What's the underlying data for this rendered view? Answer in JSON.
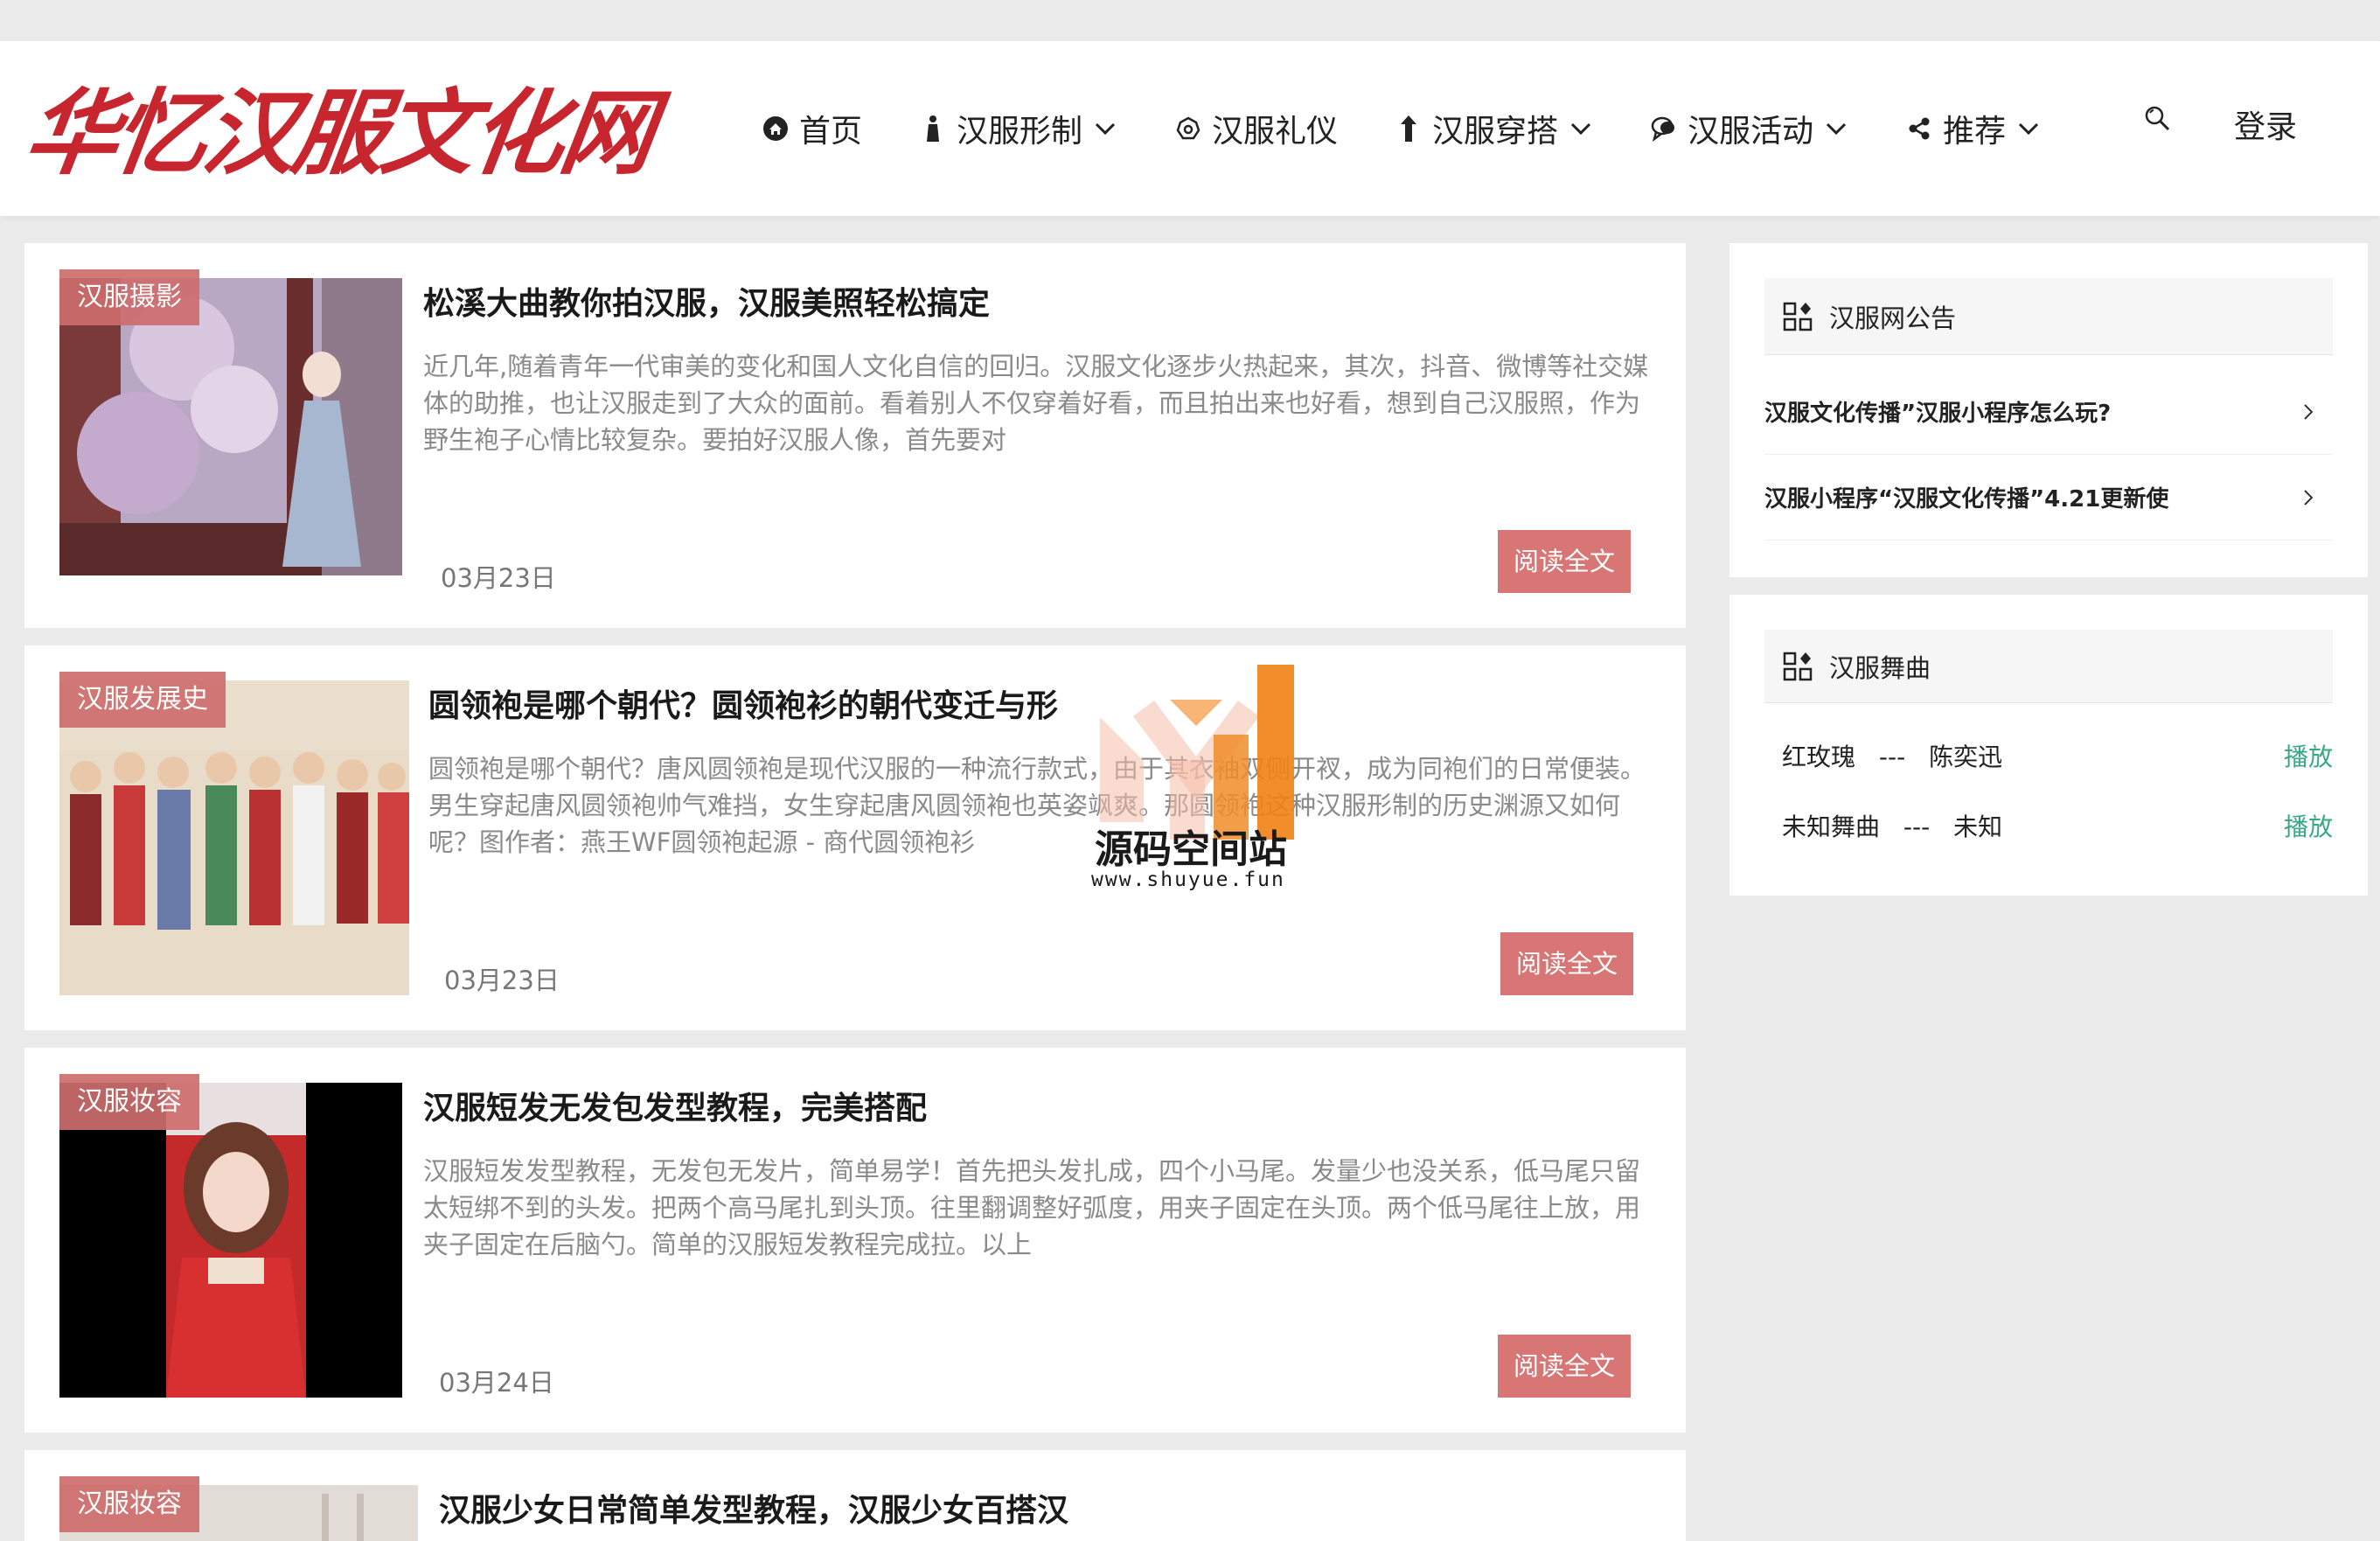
{
  "header": {
    "logo_text": "华忆汉服文化网",
    "nav": [
      {
        "label": "首页",
        "icon": "home-icon",
        "dropdown": false
      },
      {
        "label": "汉服形制",
        "icon": "figure-icon",
        "dropdown": true
      },
      {
        "label": "汉服礼仪",
        "icon": "gear-icon",
        "dropdown": false
      },
      {
        "label": "汉服穿搭",
        "icon": "shirt-icon",
        "dropdown": true
      },
      {
        "label": "汉服活动",
        "icon": "chat-icon",
        "dropdown": true
      },
      {
        "label": "推荐",
        "icon": "share-icon",
        "dropdown": true
      }
    ],
    "login": "登录"
  },
  "posts": [
    {
      "tag": "汉服摄影",
      "title": "松溪大曲教你拍汉服，汉服美照轻松搞定",
      "excerpt": "近几年,随着青年一代审美的变化和国人文化自信的回归。汉服文化逐步火热起来，其次，抖音、微博等社交媒体的助推，也让汉服走到了大众的面前。看着别人不仅穿着好看，而且拍出来也好看，想到自己汉服照，作为野生袍子心情比较复杂。要拍好汉服人像，首先要对",
      "date": "03月23日",
      "read": "阅读全文"
    },
    {
      "tag": "汉服发展史",
      "title": "圆领袍是哪个朝代？圆领袍衫的朝代变迁与形",
      "excerpt": "圆领袍是哪个朝代？唐风圆领袍是现代汉服的一种流行款式，由于其衣袖双侧开衩，成为同袍们的日常便装。男生穿起唐风圆领袍帅气难挡，女生穿起唐风圆领袍也英姿飒爽。那圆领袍这种汉服形制的历史渊源又如何呢？图作者：燕王WF圆领袍起源 - 商代圆领袍衫",
      "date": "03月23日",
      "read": "阅读全文"
    },
    {
      "tag": "汉服妆容",
      "title": "汉服短发无发包发型教程，完美搭配",
      "excerpt": "汉服短发发型教程，无发包无发片，简单易学！首先把头发扎成，四个小马尾。发量少也没关系，低马尾只留太短绑不到的头发。把两个高马尾扎到头顶。往里翻调整好弧度，用夹子固定在头顶。两个低马尾往上放，用夹子固定在后脑勺。简单的汉服短发教程完成拉。以上",
      "date": "03月24日",
      "read": "阅读全文"
    },
    {
      "tag": "汉服妆容",
      "title": "汉服少女日常简单发型教程，汉服少女百搭汉"
    }
  ],
  "sidebar": {
    "notice_panel": {
      "title": "汉服网公告",
      "items": [
        "汉服文化传播”汉服小程序怎么玩?",
        "汉服小程序“汉服文化传播”4.21更新使"
      ]
    },
    "music_panel": {
      "title": "汉服舞曲",
      "songs": [
        {
          "name": "红玫瑰",
          "sep": "---",
          "artist": "陈奕迅",
          "play": "播放"
        },
        {
          "name": "未知舞曲",
          "sep": "---",
          "artist": "未知",
          "play": "播放"
        }
      ]
    }
  },
  "watermark": {
    "cn": "源码空间站",
    "url": "www.shuyue.fun"
  },
  "colors": {
    "accent": "#c8262f",
    "tag": "#cd6c6c",
    "button": "#d87676",
    "play": "#3aa884"
  }
}
